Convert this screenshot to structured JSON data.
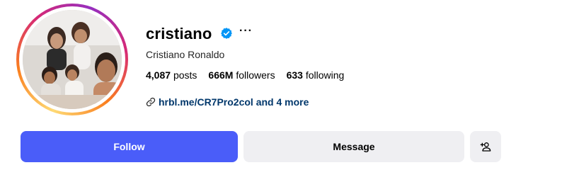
{
  "profile": {
    "username": "cristiano",
    "full_name": "Cristiano Ronaldo",
    "verified": true,
    "more_label": "···"
  },
  "stats": {
    "posts_count": "4,087",
    "posts_label": "posts",
    "followers_count": "666M",
    "followers_label": "followers",
    "following_count": "633",
    "following_label": "following"
  },
  "link": {
    "text": "hrbl.me/CR7Pro2col and 4 more",
    "icon": "link-icon"
  },
  "actions": {
    "follow_label": "Follow",
    "message_label": "Message",
    "add_user_icon": "person-plus-icon"
  },
  "colors": {
    "follow_bg": "#4a5df9",
    "secondary_bg": "#efeff2",
    "verified": "#0095f6",
    "link": "#00376b"
  }
}
